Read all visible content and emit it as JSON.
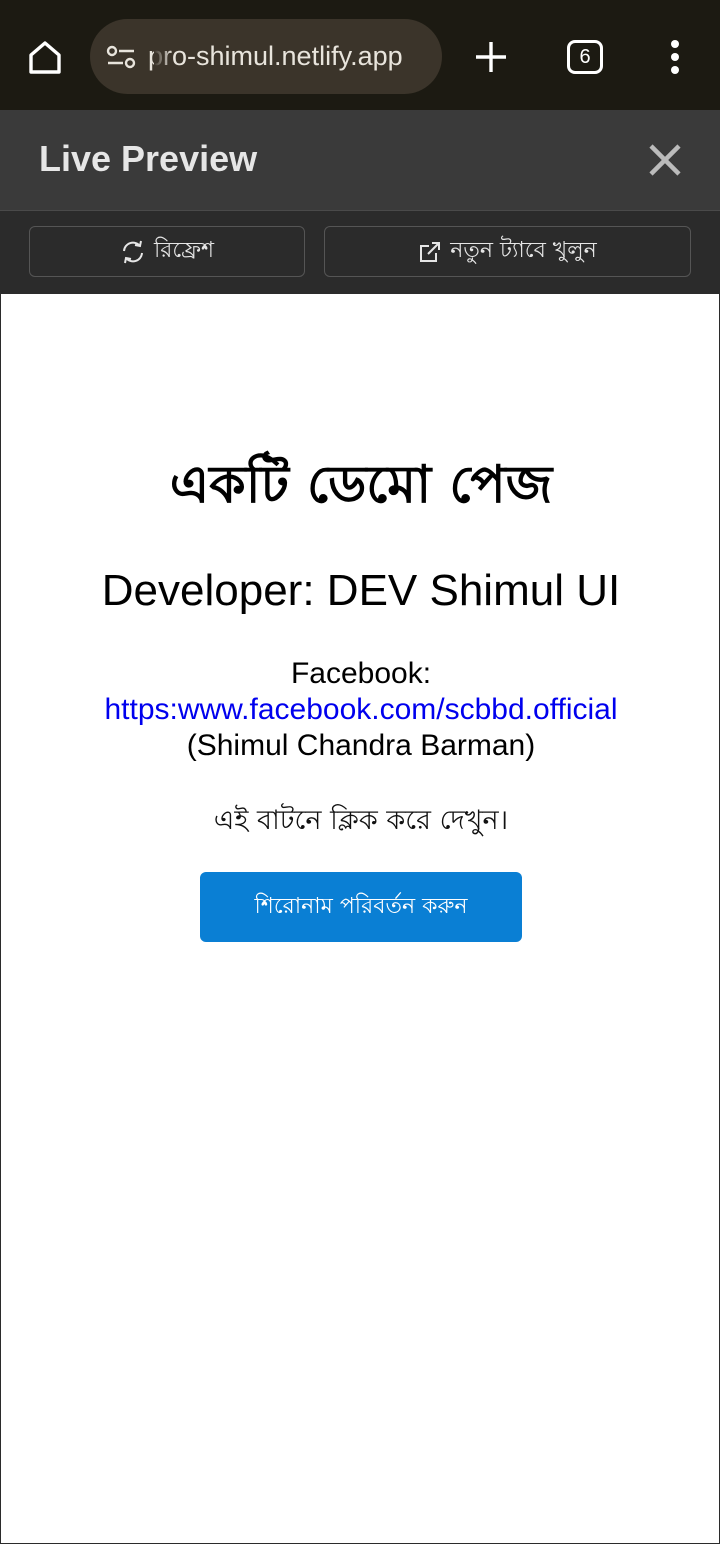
{
  "browser": {
    "url": "pro-shimul.netlify.app",
    "tab_count": "6",
    "icons": {
      "home": "home-icon",
      "site_settings": "site-settings-icon",
      "new_tab": "plus-icon",
      "tabs": "tabs-icon",
      "menu": "more-vert-icon"
    }
  },
  "panel": {
    "title": "Live Preview",
    "close_icon": "close-icon",
    "refresh_label": "রিফ্রেশ",
    "open_new_tab_label": "নতুন ট্যাবে খুলুন"
  },
  "preview": {
    "heading": "একটি ডেমো পেজ",
    "developer_line": "Developer: DEV Shimul UI",
    "facebook_label": "Facebook:",
    "facebook_link": "https:www.facebook.com/scbbd.official",
    "facebook_name": "(Shimul Chandra Barman)",
    "hint": "এই বাটনে ক্লিক করে দেখুন।",
    "button_label": "শিরোনাম পরিবর্তন করুন"
  },
  "colors": {
    "browser_bar": "#1c1a12",
    "panel_header": "#3a3a3a",
    "toolbar": "#2b2b2b",
    "button_blue": "#0a7fd4",
    "link_blue": "#0000ee"
  }
}
